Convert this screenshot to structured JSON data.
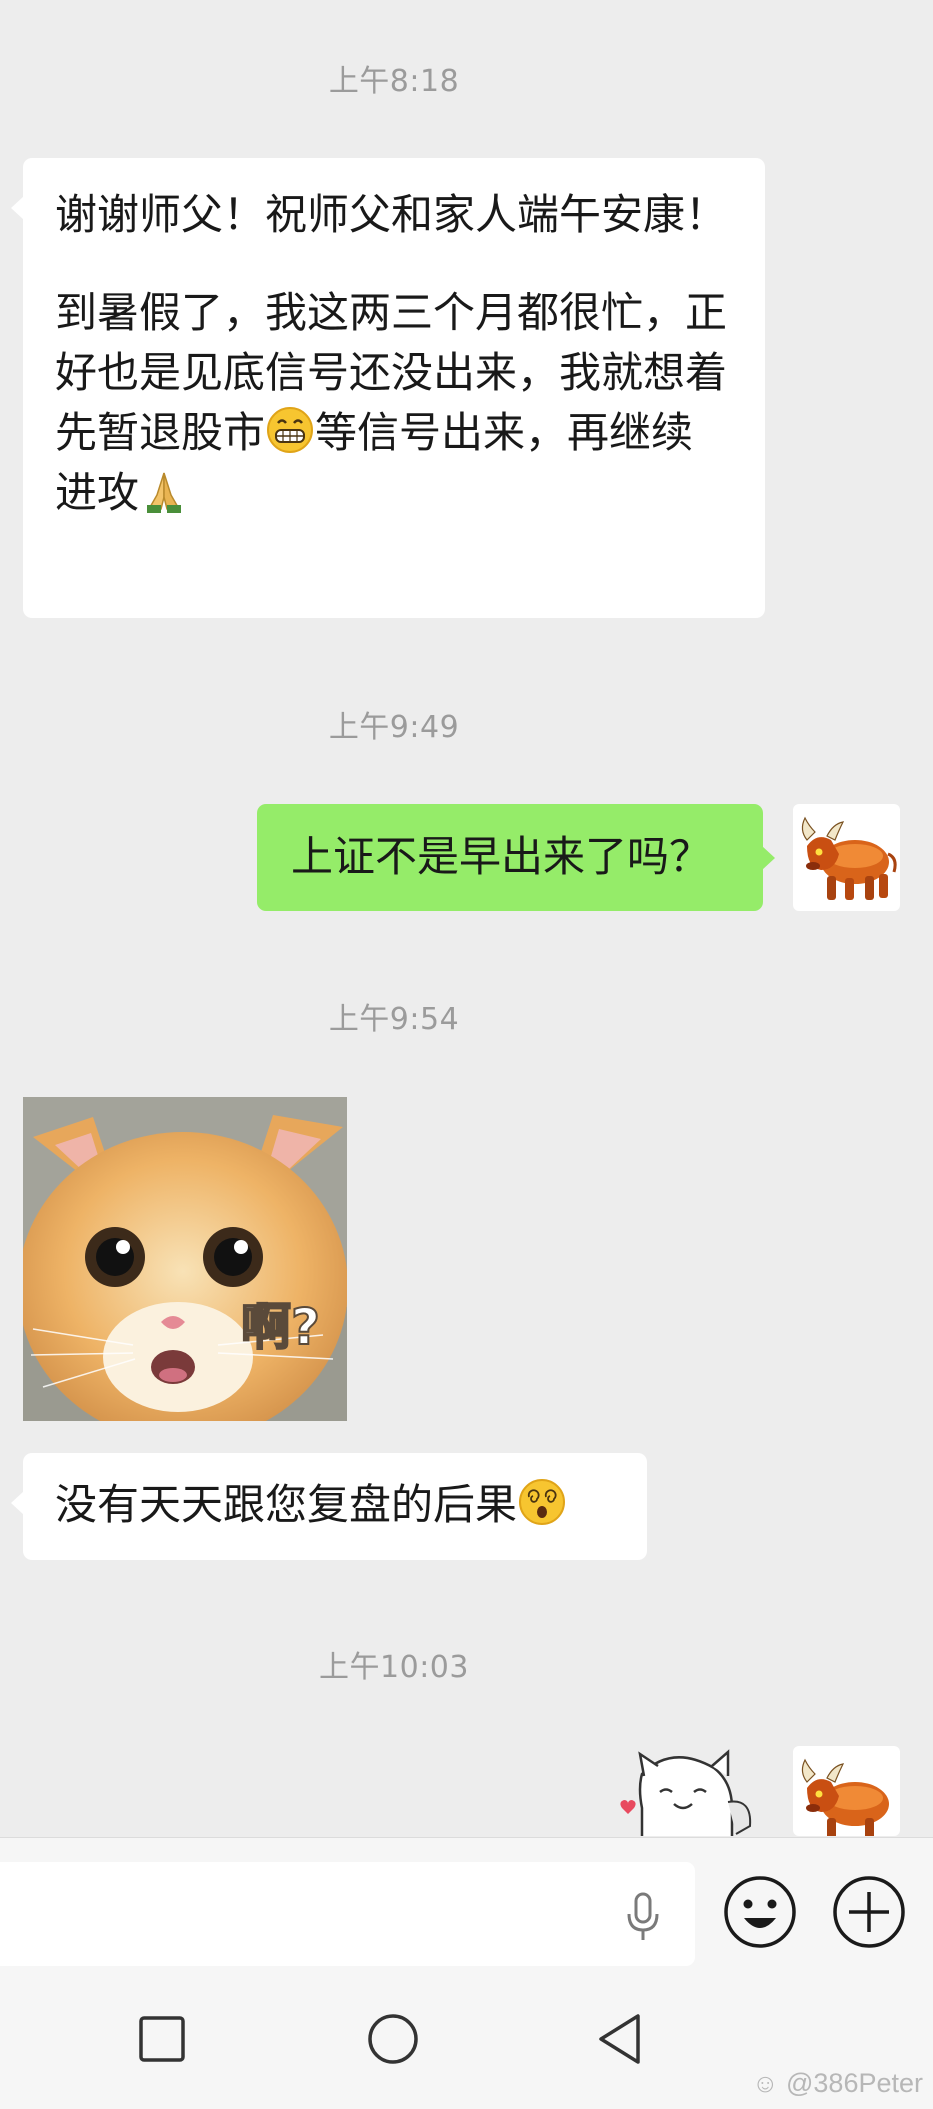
{
  "messages": {
    "ts1": "上午8:18",
    "msg1_p1": "谢谢师父！祝师父和家人端午安康！",
    "msg1_p2a": "到暑假了，我这两三个月都很忙，正好也是见底信号还没出来，我就想着先暂退股市",
    "msg1_p2b": "等信号出来，再继续进攻",
    "ts2": "上午9:49",
    "msg2": "上证不是早出来了吗？",
    "ts3": "上午9:54",
    "sticker_text": "啊?",
    "msg3": "没有天天跟您复盘的后果",
    "ts4": "上午10:03"
  },
  "icons": {
    "emoji_grin": "grinning-face-emoji",
    "emoji_pray": "folded-hands-emoji",
    "emoji_dizzy": "dizzy-face-emoji",
    "avatar": "orange-bull-avatar",
    "mic": "microphone-icon",
    "emoji_btn": "smiley-icon",
    "plus_btn": "plus-circle-icon",
    "nav_recent": "square-icon",
    "nav_home": "circle-icon",
    "nav_back": "triangle-back-icon"
  },
  "colors": {
    "background": "#ededed",
    "incoming_bubble": "#ffffff",
    "outgoing_bubble": "#95ec69"
  },
  "watermark": "@386Peter"
}
